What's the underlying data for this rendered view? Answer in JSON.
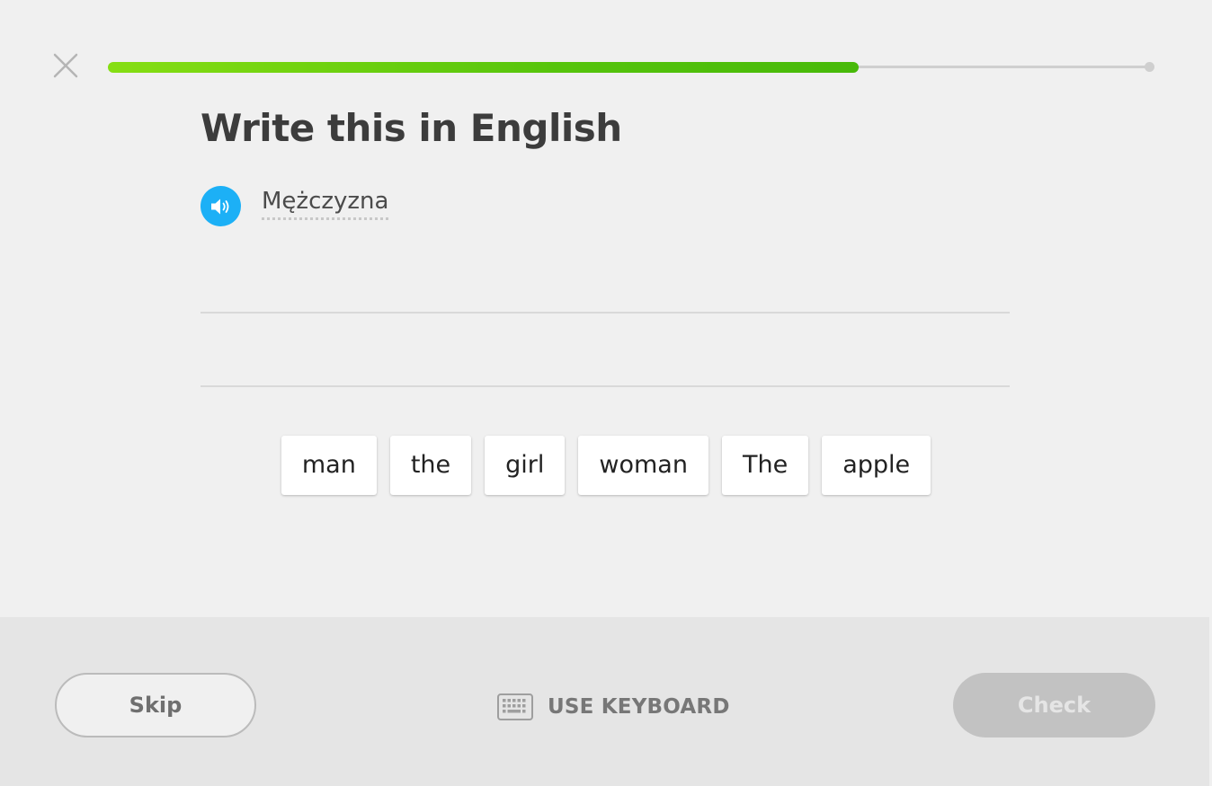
{
  "header": {
    "close_icon": "close-icon",
    "progress": 0.72
  },
  "challenge": {
    "title": "Write this in English",
    "speaker_icon": "speaker-icon",
    "source_text": "Mężczyzna"
  },
  "word_bank": [
    {
      "label": "man"
    },
    {
      "label": "the"
    },
    {
      "label": "girl"
    },
    {
      "label": "woman"
    },
    {
      "label": "The"
    },
    {
      "label": "apple"
    }
  ],
  "footer": {
    "skip_label": "Skip",
    "keyboard_icon": "keyboard-icon",
    "keyboard_label": "USE KEYBOARD",
    "check_label": "Check"
  },
  "colors": {
    "progress_green": "#58cc02",
    "speaker_blue": "#1cb0f6",
    "check_disabled": "#c2c2c2"
  }
}
